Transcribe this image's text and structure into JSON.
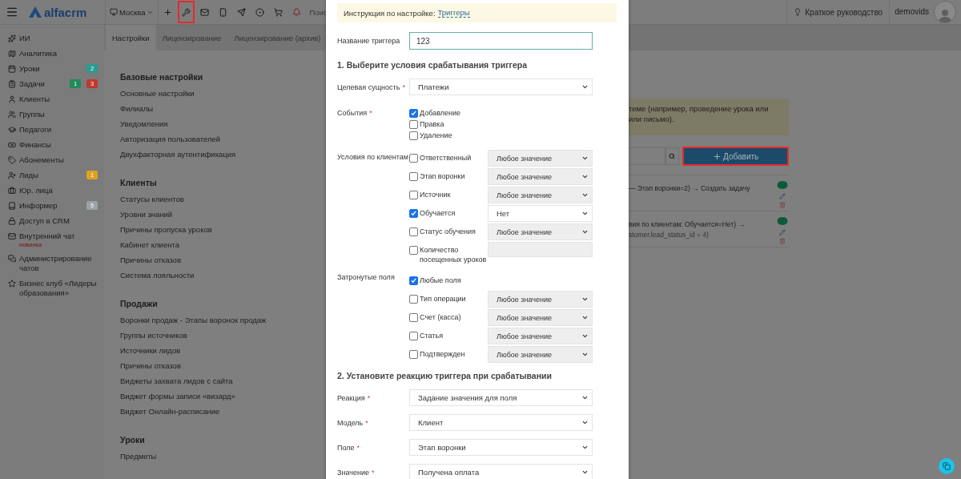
{
  "top_bar": {
    "logo": "alfacrm",
    "branch": "Москва",
    "tools": [
      {
        "kind": "plus",
        "highlighted": false
      },
      {
        "kind": "wrench",
        "highlighted": true
      },
      {
        "kind": "mail",
        "highlighted": false
      },
      {
        "kind": "phone",
        "highlighted": false
      },
      {
        "kind": "telegram",
        "highlighted": false
      },
      {
        "kind": "circle",
        "highlighted": false
      },
      {
        "kind": "cart",
        "highlighted": false
      },
      {
        "kind": "bell",
        "highlighted": false
      }
    ],
    "search_placeholder": "Поис",
    "guide": "Краткое руководство",
    "user": "demovids"
  },
  "sidebar": {
    "items": [
      {
        "kind": "sparkles",
        "label": "ИИ"
      },
      {
        "kind": "map",
        "label": "Аналитика"
      },
      {
        "kind": "calendar",
        "label": "Уроки",
        "badges": [
          {
            "text": "2",
            "color": "#2a9d93"
          }
        ]
      },
      {
        "kind": "clipboard",
        "label": "Задачи",
        "badges": [
          {
            "text": "1",
            "color": "#1f8a5a"
          },
          {
            "text": "3",
            "color": "#c0392b"
          }
        ]
      },
      {
        "kind": "user",
        "label": "Клиенты"
      },
      {
        "kind": "users",
        "label": "Группы"
      },
      {
        "kind": "graduation",
        "label": "Педагоги"
      },
      {
        "kind": "money",
        "label": "Финансы"
      },
      {
        "kind": "tag",
        "label": "Абонементы"
      },
      {
        "kind": "user-plus",
        "label": "Лиды",
        "badges": [
          {
            "text": "1",
            "color": "#e0a020"
          }
        ]
      },
      {
        "kind": "briefcase",
        "label": "Юр. лица"
      },
      {
        "kind": "book",
        "label": "Информер",
        "badges": [
          {
            "text": "5",
            "color": "#9aa3a8"
          }
        ]
      },
      {
        "kind": "lock",
        "label": "Доступ в CRM"
      },
      {
        "kind": "mail",
        "label": "Внутренний чат",
        "note": "новинка"
      },
      {
        "kind": "chats",
        "label": "Администрирование чатов"
      },
      {
        "kind": "star",
        "label": "Бизнес клуб «Лидеры образования»"
      }
    ]
  },
  "tabs": [
    {
      "label": "Настройки",
      "selected": true
    },
    {
      "label": "Лицензирование",
      "selected": false
    },
    {
      "label": "Лицензирование (архив)",
      "selected": false
    }
  ],
  "settings": [
    {
      "title": "Базовые настройки",
      "items": [
        "Основные настройки",
        "Филиалы",
        "Уведомления",
        "Авторизация пользователей",
        "Двухфакторная аутентификация"
      ]
    },
    {
      "title": "Клиенты",
      "items": [
        "Статусы клиентов",
        "Уровни знаний",
        "Причины пропуска уроков",
        "Кабинет клиента",
        "Причины отказов",
        "Система лояльности"
      ]
    },
    {
      "title": "Продажи",
      "items": [
        "Воронки продаж - Этапы воронок продаж",
        "Группы источников",
        "Источники лидов",
        "Причины отказов",
        "Виджеты захвата лидов с сайта",
        "Виджет формы записи «визард»",
        "Виджет Онлайн-расписание"
      ]
    },
    {
      "title": "Уроки",
      "items": [
        "Предметы"
      ]
    }
  ],
  "triggers_panel": {
    "notice_lines": [
      "теме (например, проведение урока или",
      "или письмо)."
    ],
    "add_button": {
      "label": "Добавить",
      "highlighted": true
    },
    "rows": [
      {
        "lines": [
          "— Этап воронки=2) → Создать задачу"
        ],
        "enabled": true
      },
      {
        "lines": [
          "вия по клиентам: Обучается=Нет) →",
          "stomer.lead_status_id = 4)"
        ],
        "enabled": true
      }
    ]
  },
  "modal": {
    "notice": {
      "text": "Инструкция по настройке:",
      "link": "Триггеры"
    },
    "name": {
      "label": "Название триггера",
      "value": "123"
    },
    "section_1": "1. Выберите условия срабатывания триггера",
    "target": {
      "label": "Целевая сущность",
      "required_mark": "*",
      "value": "Платежи"
    },
    "events": {
      "label": "События",
      "required_mark": "*",
      "options": [
        {
          "label": "Добавление",
          "checked": true
        },
        {
          "label": "Правка",
          "checked": false
        },
        {
          "label": "Удаление",
          "checked": false
        }
      ]
    },
    "client_conditions": {
      "label": "Условия по клиентам",
      "rows": [
        {
          "kind": "select",
          "label": "Ответственный",
          "checked": false,
          "value": "Любое значение"
        },
        {
          "kind": "select",
          "label": "Этап воронки",
          "checked": false,
          "value": "Любое значение"
        },
        {
          "kind": "select",
          "label": "Источник",
          "checked": false,
          "value": "Любое значение"
        },
        {
          "kind": "select",
          "label": "Обучается",
          "checked": true,
          "value": "Нет"
        },
        {
          "kind": "select",
          "label": "Статус обучения",
          "checked": false,
          "value": "Любое значение"
        },
        {
          "kind": "input",
          "label": "Количество посещенных уроков",
          "checked": false
        }
      ]
    },
    "affected_fields": {
      "label": "Затронутые поля",
      "rows": [
        {
          "kind": "checkbox",
          "label": "Любые поля",
          "checked": true
        },
        {
          "kind": "select",
          "label": "Тип операции",
          "checked": false,
          "value": "Любое значение"
        },
        {
          "kind": "select",
          "label": "Счет (касса)",
          "checked": false,
          "value": "Любое значение"
        },
        {
          "kind": "select",
          "label": "Статья",
          "checked": false,
          "value": "Любое значение"
        },
        {
          "kind": "select",
          "label": "Подтвержден",
          "checked": false,
          "value": "Любое значение"
        }
      ]
    },
    "section_2": "2. Установите реакцию триггера при срабатывании",
    "reaction": [
      {
        "label": "Реакция",
        "required_mark": "*",
        "value": "Задание значения для поля"
      },
      {
        "label": "Модель",
        "required_mark": "*",
        "value": "Клиент"
      },
      {
        "label": "Поле",
        "required_mark": "*",
        "value": "Этап воронки"
      },
      {
        "label": "Значение",
        "required_mark": "*",
        "value": "Получена оплата"
      }
    ]
  }
}
